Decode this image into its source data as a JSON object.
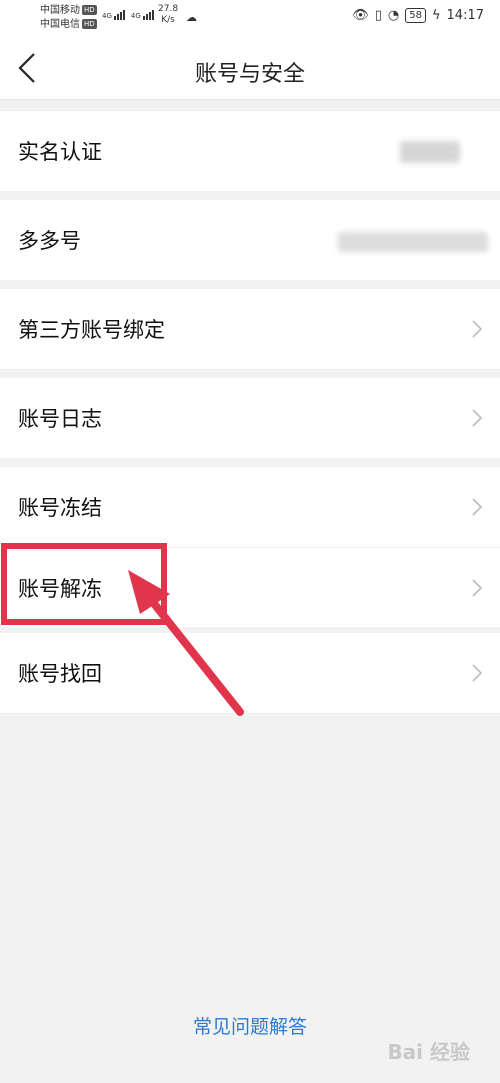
{
  "status_bar": {
    "carrier1": "中国移动",
    "carrier2": "中国电信",
    "hd_label": "HD",
    "net1": "4G",
    "net2": "4G",
    "speed_value": "27.8",
    "speed_unit": "K/s",
    "battery": "58",
    "time": "14:17"
  },
  "navbar": {
    "title": "账号与安全",
    "back_icon": "chevron-left-icon"
  },
  "menu": {
    "real_name": "实名认证",
    "duoduo_id": "多多号",
    "third_party": "第三方账号绑定",
    "log": "账号日志",
    "freeze": "账号冻结",
    "unfreeze": "账号解冻",
    "recover": "账号找回"
  },
  "footer": {
    "faq": "常见问题解答",
    "watermark": "Bai 经验"
  },
  "colors": {
    "accent": "#2b7bd6",
    "annotation": "#e0354a",
    "background": "#f2f2f2"
  }
}
